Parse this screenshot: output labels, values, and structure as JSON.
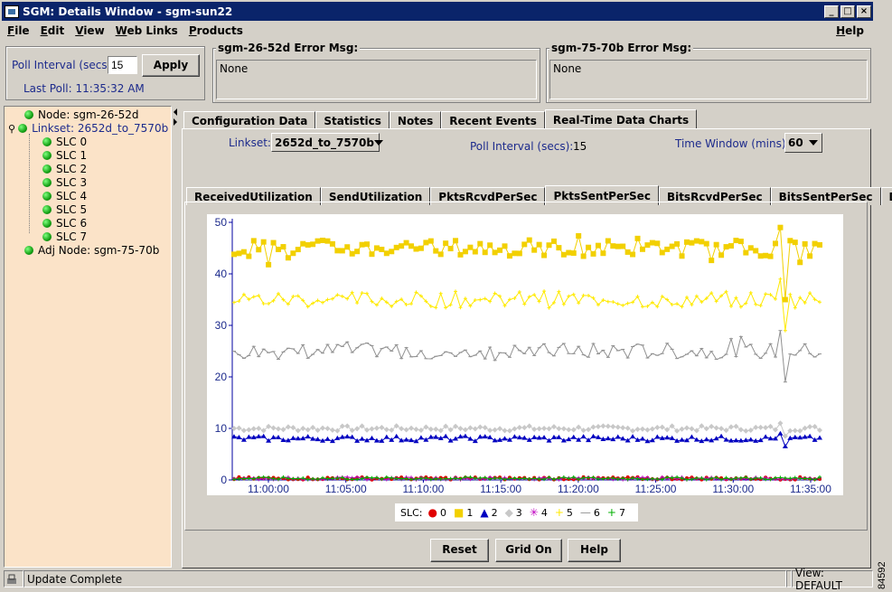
{
  "window": {
    "title": "SGM: Details Window - sgm-sun22"
  },
  "menu": {
    "items": [
      "File",
      "Edit",
      "View",
      "Web Links",
      "Products"
    ],
    "help": "Help"
  },
  "poll": {
    "label": "Poll Interval (secs)",
    "value": "15",
    "apply": "Apply",
    "last_poll": "Last Poll:  11:35:32 AM"
  },
  "errors": [
    {
      "title": "sgm-26-52d  Error Msg:",
      "text": "None"
    },
    {
      "title": "sgm-75-70b  Error Msg:",
      "text": "None"
    }
  ],
  "tree": {
    "node": "Node: sgm-26-52d",
    "linkset": "Linkset: 2652d_to_7570b",
    "slcs": [
      "SLC 0",
      "SLC 1",
      "SLC 2",
      "SLC 3",
      "SLC 4",
      "SLC 5",
      "SLC 6",
      "SLC 7"
    ],
    "adj": "Adj Node: sgm-75-70b"
  },
  "main_tabs": [
    "Configuration Data",
    "Statistics",
    "Notes",
    "Recent Events",
    "Real-Time Data Charts"
  ],
  "controls": {
    "linkset_label": "Linkset:",
    "linkset_value": "2652d_to_7570b",
    "poll_label": "Poll Interval (secs):",
    "poll_value": "15",
    "window_label": "Time Window (mins):",
    "window_value": "60"
  },
  "chart_tabs": [
    "ReceivedUtilization",
    "SendUtilization",
    "PktsRcvdPerSec",
    "PktsSentPerSec",
    "BitsRcvdPerSec",
    "BitsSentPerSec",
    "Drops"
  ],
  "chart_data": {
    "type": "line",
    "x": [
      "11:00:00",
      "11:05:00",
      "11:10:00",
      "11:15:00",
      "11:20:00",
      "11:25:00",
      "11:30:00",
      "11:35:00"
    ],
    "ylim": [
      0,
      50
    ],
    "yticks": [
      0,
      10,
      20,
      30,
      40,
      50
    ],
    "legend_title": "SLC:",
    "series": [
      {
        "name": "0",
        "color": "#e00000",
        "marker": "circle",
        "level": 0.3
      },
      {
        "name": "1",
        "color": "#f2d000",
        "marker": "square",
        "level": 45
      },
      {
        "name": "2",
        "color": "#0000c0",
        "marker": "triangle",
        "level": 8
      },
      {
        "name": "3",
        "color": "#c8c8c8",
        "marker": "diamond",
        "level": 10
      },
      {
        "name": "4",
        "color": "#c000c0",
        "marker": "asterisk",
        "level": 0.3
      },
      {
        "name": "5",
        "color": "#ffea00",
        "marker": "plus",
        "level": 35
      },
      {
        "name": "6",
        "color": "#909090",
        "marker": "dash",
        "level": 25
      },
      {
        "name": "7",
        "color": "#00b000",
        "marker": "plus",
        "level": 0.3
      }
    ]
  },
  "buttons": {
    "reset": "Reset",
    "grid": "Grid On",
    "help": "Help"
  },
  "status": {
    "text": "Update Complete",
    "view": "View: DEFAULT"
  },
  "side_code": "84592"
}
